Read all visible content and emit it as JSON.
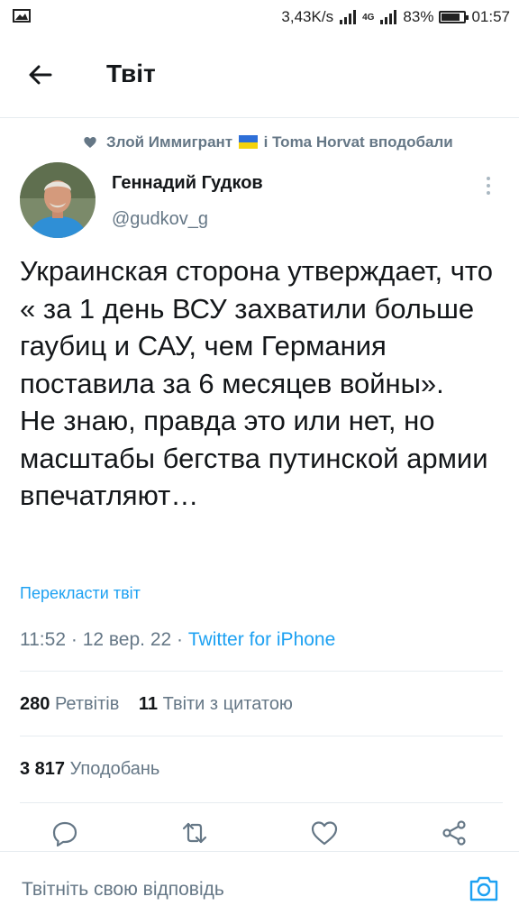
{
  "status_bar": {
    "speed": "3,43K/s",
    "network": "4G",
    "battery_percent": "83%",
    "battery_level": 0.83,
    "time": "01:57"
  },
  "header": {
    "title": "Твіт"
  },
  "social_context": {
    "user_one": "Злой Иммигрант",
    "connector": "і",
    "user_two": "Toma Horvat",
    "action": "вподобали"
  },
  "tweet": {
    "author_name": "Геннадий Гудков",
    "author_handle": "@gudkov_g",
    "text": "Украинская сторона утверждает, что « за 1 день ВСУ захватили больше гаубиц и САУ, чем Германия поставила за 6 месяцев войны».\nНе знаю, правда это или нет, но масштабы бегства путинской армии впечатляют…",
    "translate_label": "Перекласти твіт",
    "time": "11:52",
    "date": "12 вер. 22",
    "source": "Twitter for iPhone"
  },
  "stats": {
    "retweets_count": "280",
    "retweets_label": "Ретвітів",
    "quotes_count": "11",
    "quotes_label": "Твіти з цитатою",
    "likes_count": "3 817",
    "likes_label": "Уподобань"
  },
  "reply": {
    "placeholder": "Твітніть свою відповідь"
  },
  "colors": {
    "accent": "#1da1f2",
    "secondary_text": "#657786",
    "primary_text": "#14171a",
    "divider": "#e6ecf0"
  },
  "icons": [
    "back-arrow-icon",
    "heart-icon",
    "ukraine-flag-icon",
    "more-vertical-icon",
    "reply-icon",
    "retweet-icon",
    "like-icon",
    "share-icon",
    "camera-icon"
  ]
}
